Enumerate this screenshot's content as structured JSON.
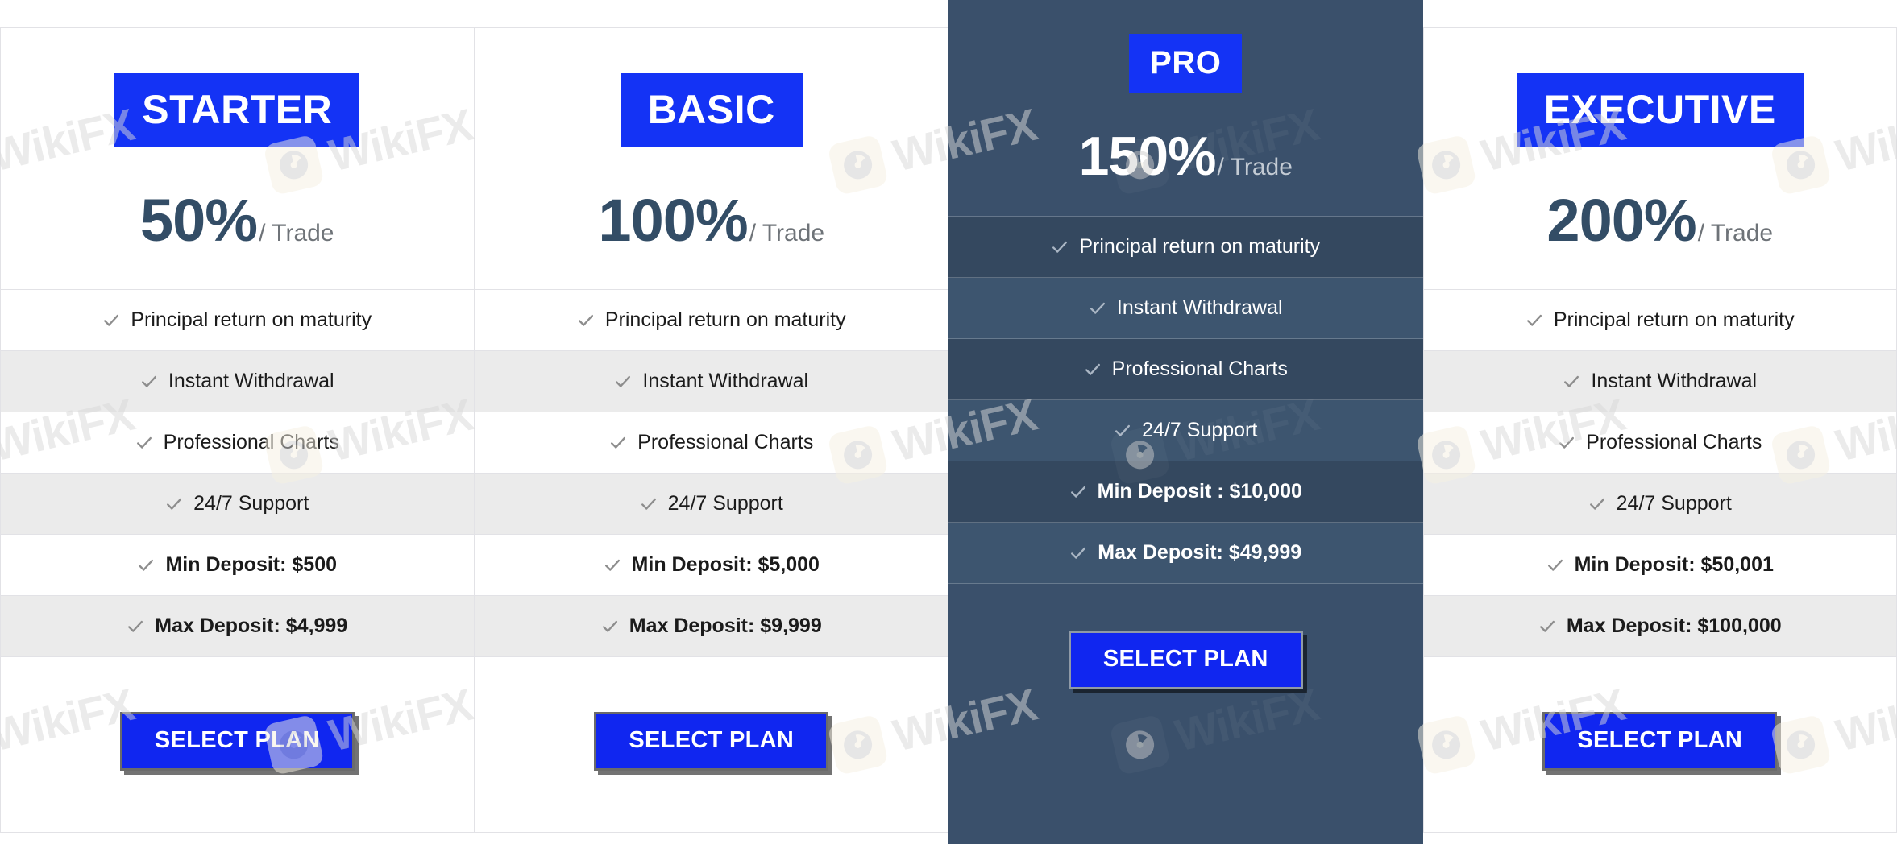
{
  "colors": {
    "badge_blue": "#1433f5",
    "price_navy": "#334d66",
    "featured_bg": "#3a506b",
    "row_alt": "#ebebeb",
    "button_blue": "#1026f0",
    "check_gray": "#8d8d8d"
  },
  "watermark": {
    "text": "WikiFX",
    "logo_icon": "wikifx-lion-logo-icon"
  },
  "icons": {
    "check": "check-icon"
  },
  "cta_label": "SELECT PLAN",
  "per_unit": "/ Trade",
  "plans": [
    {
      "name": "STARTER",
      "price": "50%",
      "per": "/ Trade",
      "featured": false,
      "features": [
        {
          "label": "Principal return on maturity",
          "strong": false
        },
        {
          "label": "Instant Withdrawal",
          "strong": false
        },
        {
          "label": "Professional Charts",
          "strong": false
        },
        {
          "label": "24/7 Support",
          "strong": false
        },
        {
          "label": "Min Deposit: $500",
          "strong": true
        },
        {
          "label": "Max Deposit: $4,999",
          "strong": true
        }
      ],
      "cta": "SELECT PLAN"
    },
    {
      "name": "BASIC",
      "price": "100%",
      "per": "/ Trade",
      "featured": false,
      "features": [
        {
          "label": "Principal return on maturity",
          "strong": false
        },
        {
          "label": "Instant Withdrawal",
          "strong": false
        },
        {
          "label": "Professional Charts",
          "strong": false
        },
        {
          "label": "24/7 Support",
          "strong": false
        },
        {
          "label": "Min Deposit: $5,000",
          "strong": true
        },
        {
          "label": "Max Deposit: $9,999",
          "strong": true
        }
      ],
      "cta": "SELECT PLAN"
    },
    {
      "name": "PRO",
      "price": "150%",
      "per": "/ Trade",
      "featured": true,
      "features": [
        {
          "label": "Principal return on maturity",
          "strong": false
        },
        {
          "label": "Instant Withdrawal",
          "strong": false
        },
        {
          "label": "Professional Charts",
          "strong": false
        },
        {
          "label": "24/7 Support",
          "strong": false
        },
        {
          "label": "Min Deposit : $10,000",
          "strong": true
        },
        {
          "label": "Max Deposit: $49,999",
          "strong": true
        }
      ],
      "cta": "SELECT PLAN"
    },
    {
      "name": "EXECUTIVE",
      "price": "200%",
      "per": "/ Trade",
      "featured": false,
      "features": [
        {
          "label": "Principal return on maturity",
          "strong": false
        },
        {
          "label": "Instant Withdrawal",
          "strong": false
        },
        {
          "label": "Professional Charts",
          "strong": false
        },
        {
          "label": "24/7 Support",
          "strong": false
        },
        {
          "label": "Min Deposit: $50,001",
          "strong": true
        },
        {
          "label": "Max Deposit: $100,000",
          "strong": true
        }
      ],
      "cta": "SELECT PLAN"
    }
  ]
}
